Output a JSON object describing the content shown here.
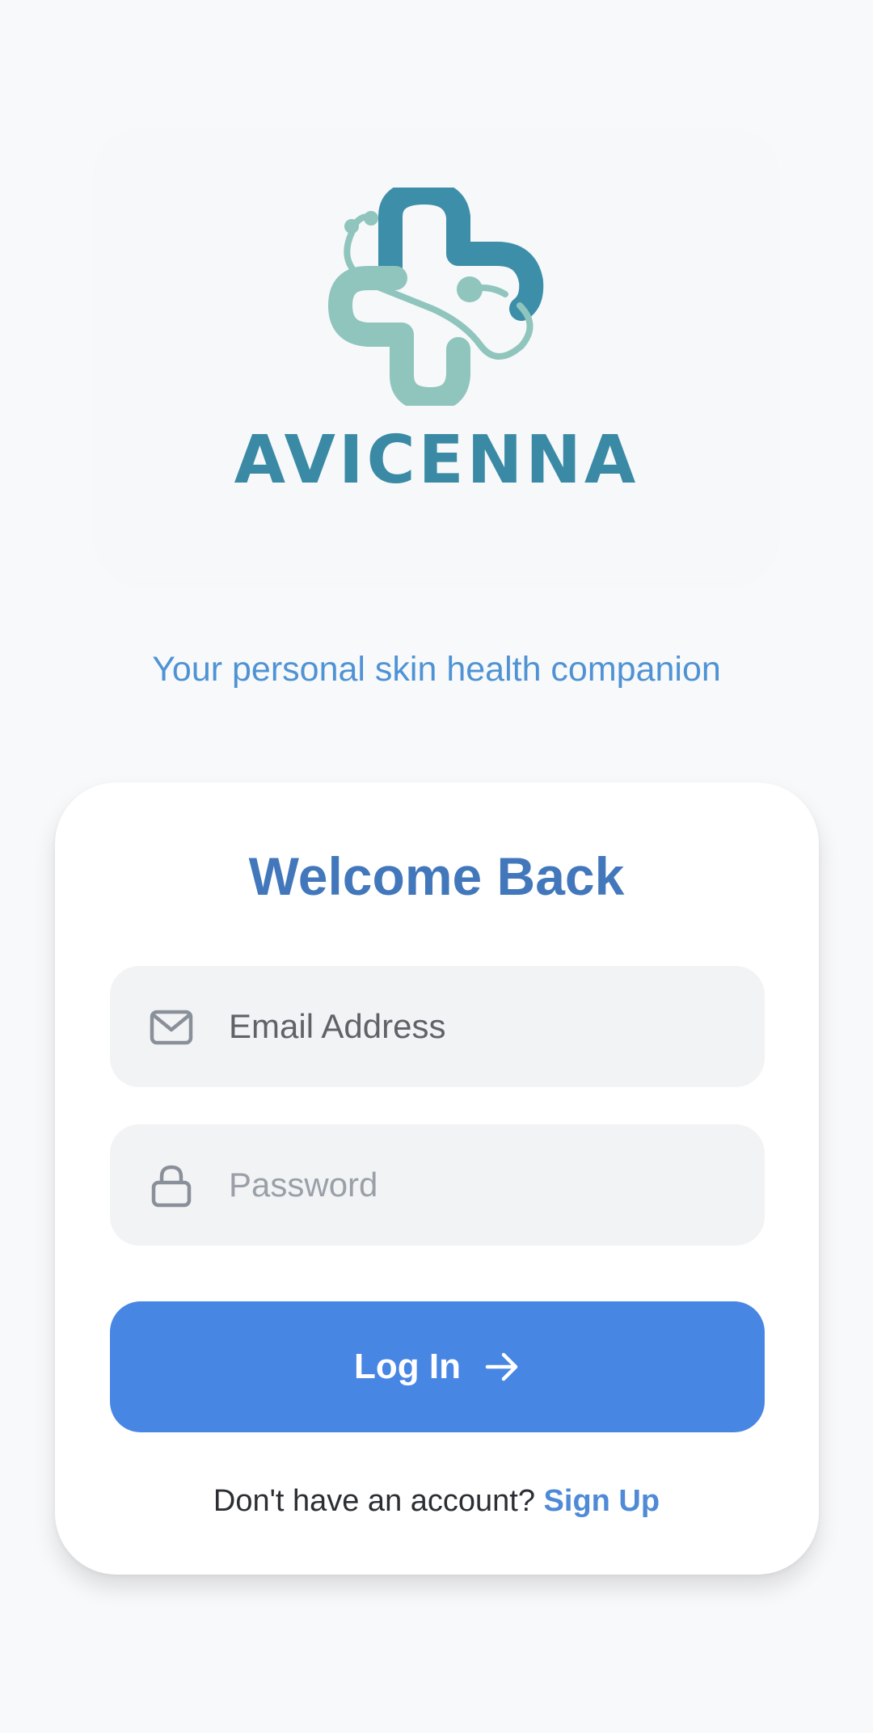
{
  "brand": {
    "name": "AVICENNA",
    "tagline": "Your personal skin health companion",
    "colors": {
      "teal_dark": "#3b8aa5",
      "teal_light": "#8ec6bf"
    },
    "logo_icon": "medical-cross-stethoscope-icon"
  },
  "login": {
    "title": "Welcome Back",
    "email_placeholder": "Email Address",
    "email_icon": "mail-icon",
    "password_placeholder": "Password",
    "password_icon": "lock-icon",
    "button_label": "Log In",
    "button_icon": "arrow-right-icon",
    "signup_prompt": "Don't have an account?",
    "signup_link": "Sign Up"
  },
  "colors": {
    "background": "#f8f9fb",
    "primary": "#4886e4",
    "title": "#4278bb",
    "field_bg": "#f2f3f5"
  }
}
